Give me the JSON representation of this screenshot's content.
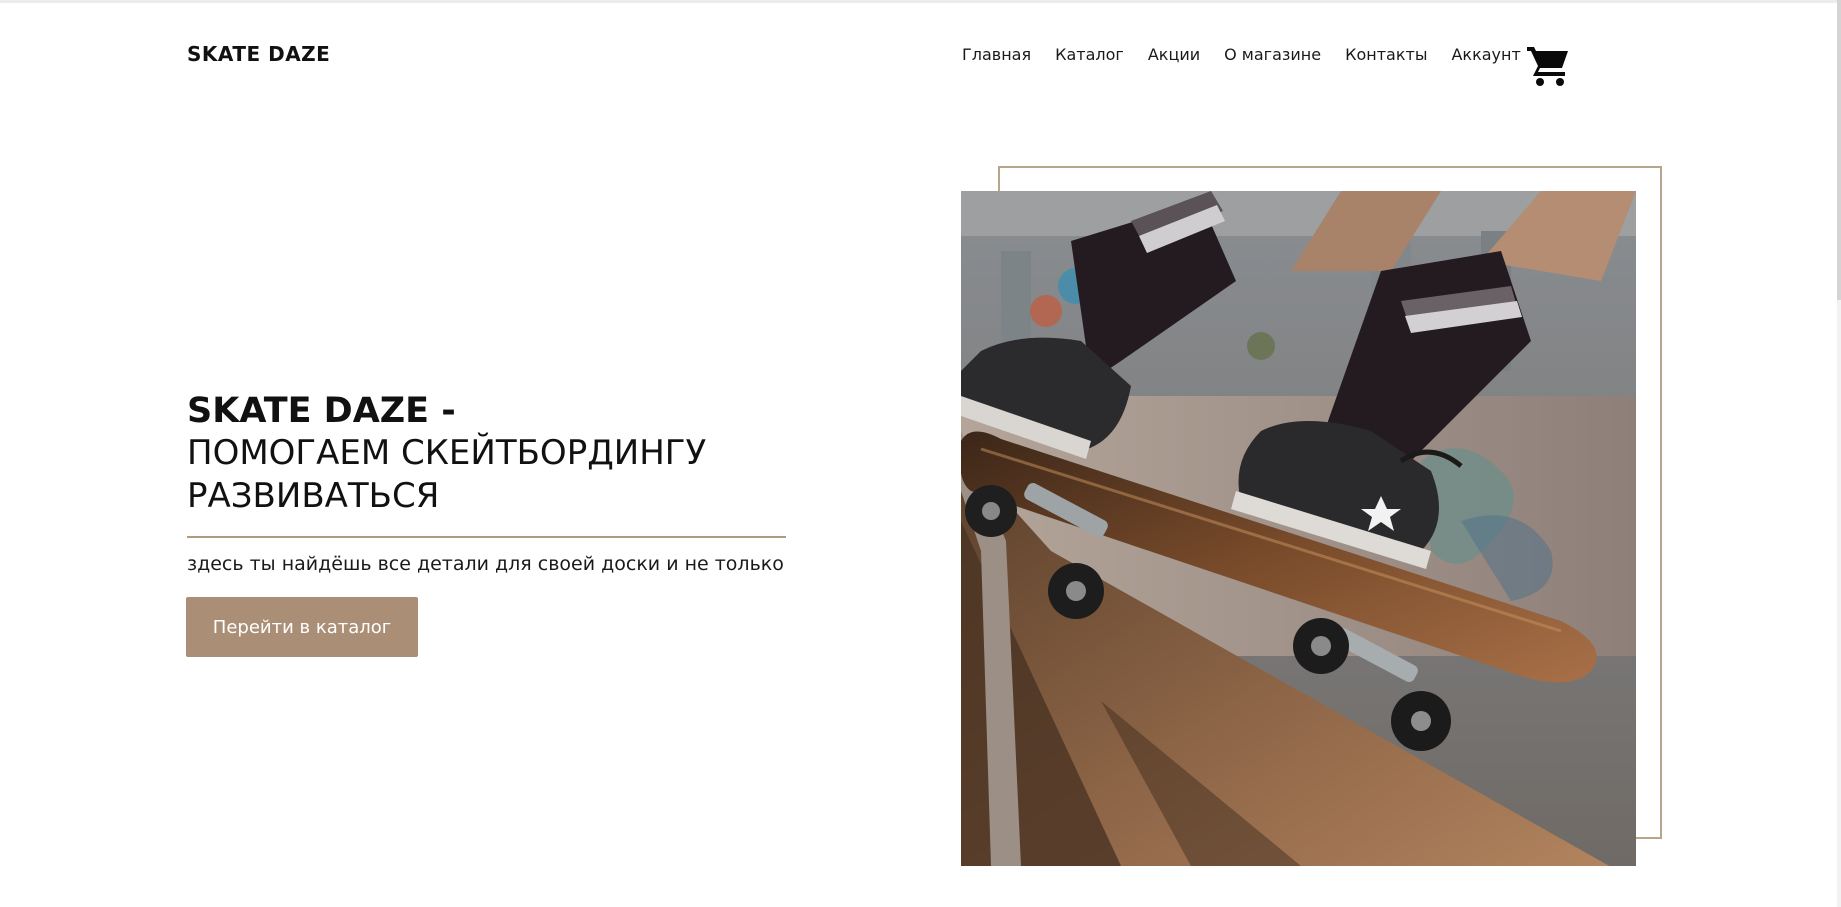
{
  "header": {
    "logo": "SKATE DAZE",
    "nav": [
      {
        "label": "Главная"
      },
      {
        "label": "Каталог"
      },
      {
        "label": "Акции"
      },
      {
        "label": "О магазине"
      },
      {
        "label": "Контакты"
      },
      {
        "label": "Аккаунт"
      }
    ],
    "cart_icon": "shopping-cart-icon"
  },
  "hero": {
    "brand": "SKATE DAZE -",
    "line1": "ПОМОГАЕМ СКЕЙТБОРДИНГУ",
    "line2": "РАЗВИВАТЬСЯ",
    "subtitle": "здесь ты найдёшь все детали для своей доски и не только",
    "cta_label": "Перейти в каталог"
  },
  "colors": {
    "accent": "#ab8e76",
    "frame": "#b9a48c",
    "text": "#111111",
    "background": "#ffffff"
  }
}
